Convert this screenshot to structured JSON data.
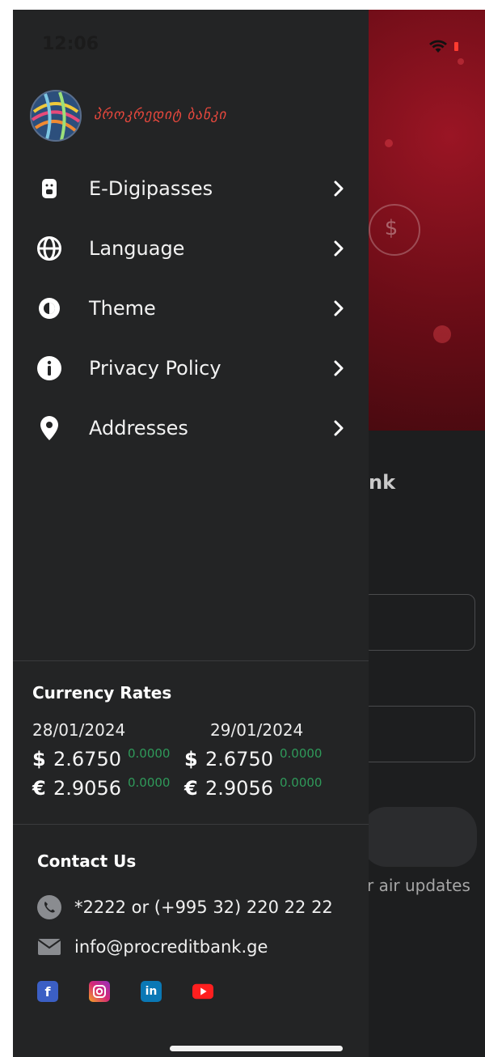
{
  "status_bar": {
    "time": "12:06"
  },
  "brand": {
    "logo_text": "პროკრედიტ ბანკი",
    "accent": "#e8483d"
  },
  "menu": {
    "items": [
      {
        "label": "E-Digipasses",
        "icon": "digipass-token-icon"
      },
      {
        "label": "Language",
        "icon": "globe-icon"
      },
      {
        "label": "Theme",
        "icon": "theme-contrast-icon"
      },
      {
        "label": "Privacy Policy",
        "icon": "info-icon"
      },
      {
        "label": "Addresses",
        "icon": "location-pin-icon"
      }
    ]
  },
  "currency_rates": {
    "title": "Currency Rates",
    "columns": [
      {
        "date": "28/01/2024",
        "rates": [
          {
            "symbol": "$",
            "value": "2.6750",
            "change": "0.0000"
          },
          {
            "symbol": "€",
            "value": "2.9056",
            "change": "0.0000"
          }
        ]
      },
      {
        "date": "29/01/2024",
        "rates": [
          {
            "symbol": "$",
            "value": "2.6750",
            "change": "0.0000"
          },
          {
            "symbol": "€",
            "value": "2.9056",
            "change": "0.0000"
          }
        ]
      }
    ],
    "change_color": "#2f9a5a"
  },
  "contact": {
    "title": "Contact Us",
    "phone": "*2222 or (+995 32) 220 22 22",
    "email": "info@procreditbank.ge",
    "social": [
      "facebook-icon",
      "instagram-icon",
      "linkedin-icon",
      "youtube-icon"
    ]
  },
  "background_app": {
    "title_fragment": "nk",
    "updates_fragment": "r air updates"
  }
}
